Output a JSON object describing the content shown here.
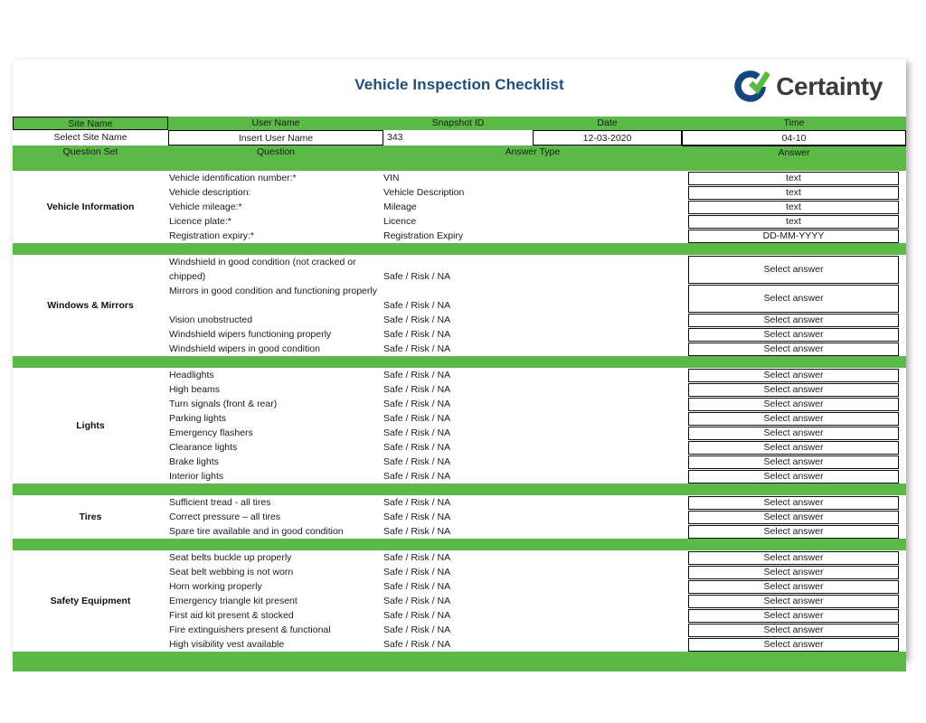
{
  "document": {
    "title": "Vehicle Inspection Checklist",
    "brand_name": "Certainty",
    "accent_green": "#5BBA47",
    "title_color": "#1F4E79",
    "brand_blue": "#14477D",
    "brand_green": "#5BBA47"
  },
  "meta": {
    "headers": {
      "site_name": "Site Name",
      "user_name": "User Name",
      "snapshot_id": "Snapshot ID",
      "date": "Date",
      "time": "Time"
    },
    "values": {
      "site_name": "Select Site Name",
      "user_name": "Insert User Name",
      "snapshot_id": "343",
      "date": "12-03-2020",
      "time": "04-10"
    }
  },
  "columns": {
    "question_set": "Question Set",
    "question": "Question",
    "answer_type": "Answer Type",
    "answer": "Answer"
  },
  "sections": [
    {
      "name": "Vehicle Information",
      "rows": [
        {
          "question": "Vehicle identification number:*",
          "answer_type": "VIN",
          "answer": "text",
          "lines": 1
        },
        {
          "question": "Vehicle description:",
          "answer_type": "Vehicle Description",
          "answer": "text",
          "lines": 1
        },
        {
          "question": "Vehicle mileage:*",
          "answer_type": "Mileage",
          "answer": "text",
          "lines": 1
        },
        {
          "question": "Licence plate:*",
          "answer_type": "Licence",
          "answer": "text",
          "lines": 1
        },
        {
          "question": "Registration expiry:*",
          "answer_type": "Registration Expiry",
          "answer": "DD-MM-YYYY",
          "lines": 1
        }
      ]
    },
    {
      "name": "Windows & Mirrors",
      "rows": [
        {
          "question": "Windshield in good condition (not cracked or chipped)",
          "answer_type": "Safe / Risk / NA",
          "answer": "Select answer",
          "lines": 2
        },
        {
          "question": "Mirrors in good condition and functioning properly",
          "answer_type": "Safe / Risk / NA",
          "answer": "Select answer",
          "lines": 2
        },
        {
          "question": "Vision unobstructed",
          "answer_type": "Safe / Risk / NA",
          "answer": "Select answer",
          "lines": 1
        },
        {
          "question": "Windshield wipers functioning properly",
          "answer_type": "Safe / Risk / NA",
          "answer": "Select answer",
          "lines": 1
        },
        {
          "question": "Windshield wipers in good condition",
          "answer_type": "Safe / Risk / NA",
          "answer": "Select answer",
          "lines": 1
        }
      ]
    },
    {
      "name": "Lights",
      "rows": [
        {
          "question": "Headlights",
          "answer_type": "Safe / Risk / NA",
          "answer": "Select answer",
          "lines": 1
        },
        {
          "question": "High beams",
          "answer_type": "Safe / Risk / NA",
          "answer": "Select answer",
          "lines": 1
        },
        {
          "question": "Turn signals (front & rear)",
          "answer_type": "Safe / Risk / NA",
          "answer": "Select answer",
          "lines": 1
        },
        {
          "question": "Parking lights",
          "answer_type": "Safe / Risk / NA",
          "answer": "Select answer",
          "lines": 1
        },
        {
          "question": "Emergency flashers",
          "answer_type": "Safe / Risk / NA",
          "answer": "Select answer",
          "lines": 1
        },
        {
          "question": "Clearance lights",
          "answer_type": "Safe / Risk / NA",
          "answer": "Select answer",
          "lines": 1
        },
        {
          "question": "Brake lights",
          "answer_type": "Safe / Risk / NA",
          "answer": "Select answer",
          "lines": 1
        },
        {
          "question": "Interior lights",
          "answer_type": "Safe / Risk / NA",
          "answer": "Select answer",
          "lines": 1
        }
      ]
    },
    {
      "name": "Tires",
      "rows": [
        {
          "question": "Sufficient tread - all tires",
          "answer_type": "Safe / Risk / NA",
          "answer": "Select answer",
          "lines": 1
        },
        {
          "question": "Correct pressure – all tires",
          "answer_type": "Safe / Risk / NA",
          "answer": "Select answer",
          "lines": 1
        },
        {
          "question": "Spare tire available and in good condition",
          "answer_type": "Safe / Risk / NA",
          "answer": "Select answer",
          "lines": 1
        }
      ]
    },
    {
      "name": "Safety Equipment",
      "rows": [
        {
          "question": "Seat belts buckle up properly",
          "answer_type": "Safe / Risk / NA",
          "answer": "Select answer",
          "lines": 1
        },
        {
          "question": "Seat belt webbing is not worn",
          "answer_type": "Safe / Risk / NA",
          "answer": "Select answer",
          "lines": 1
        },
        {
          "question": "Horn working properly",
          "answer_type": "Safe / Risk / NA",
          "answer": "Select answer",
          "lines": 1
        },
        {
          "question": "Emergency triangle kit present",
          "answer_type": "Safe / Risk / NA",
          "answer": "Select answer",
          "lines": 1
        },
        {
          "question": "First aid kit present & stocked",
          "answer_type": "Safe / Risk / NA",
          "answer": "Select answer",
          "lines": 1
        },
        {
          "question": "Fire extinguishers present & functional",
          "answer_type": "Safe / Risk / NA",
          "answer": "Select answer",
          "lines": 1
        },
        {
          "question": "High visibility vest available",
          "answer_type": "Safe / Risk / NA",
          "answer": "Select answer",
          "lines": 1
        }
      ]
    }
  ]
}
